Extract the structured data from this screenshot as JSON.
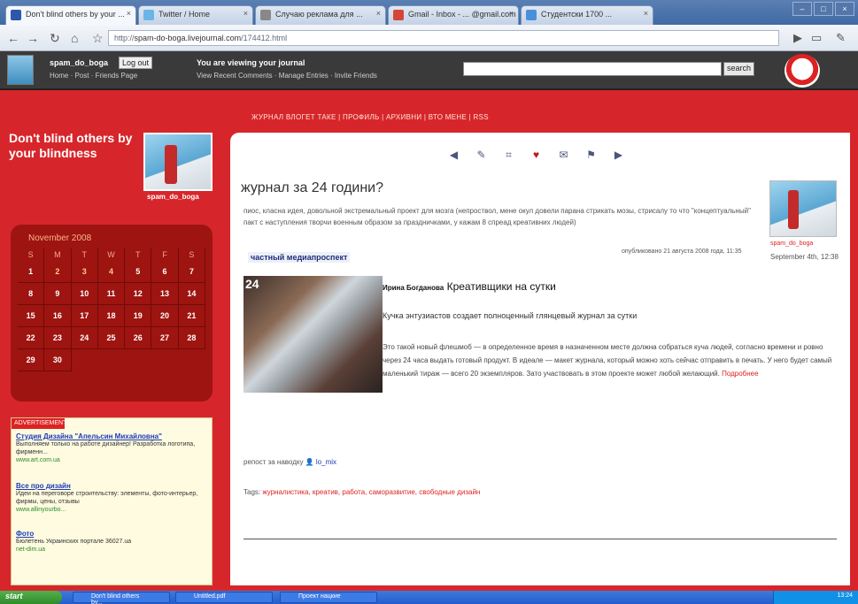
{
  "browser": {
    "tabs": [
      {
        "label": "Don't blind others by your ...",
        "color": "#2d57a8"
      },
      {
        "label": "Twitter / Home",
        "color": "#6ab4e6"
      },
      {
        "label": "Случаю реклама для ...",
        "color": "#888888"
      },
      {
        "label": "Gmail - Inbox - ... @gmail.com",
        "color": "#d44638"
      },
      {
        "label": "Студентски 1700 ...",
        "color": "#4a90d9"
      }
    ],
    "url_prefix": "http://",
    "url_host": "spam-do-boga.livejournal.com",
    "url_path": "/174412.html"
  },
  "ljbar": {
    "username": "spam_do_boga",
    "logout": "Log out",
    "user_links": "Home · Post · Friends Page",
    "viewing": "You are viewing your journal",
    "view_links": "View Recent Comments · Manage Entries · Invite Friends",
    "search_button": "search"
  },
  "topnav": "ЖУРНАЛ ВЛОГЕТ ТАКЕ  |  ПРОФИЛЬ  |  АРХИВНИ  |  ВТО МЕНЕ  |  RSS",
  "blog_title": "Don't blind others by your blindness",
  "userpic_caption": "spam_do_boga",
  "calendar": {
    "title": "November 2008",
    "dow": [
      "S",
      "M",
      "T",
      "W",
      "T",
      "F",
      "S"
    ],
    "days": [
      "1",
      "2",
      "3",
      "4",
      "5",
      "6",
      "7",
      "8",
      "9",
      "10",
      "11",
      "12",
      "13",
      "14",
      "15",
      "16",
      "17",
      "18",
      "19",
      "20",
      "21",
      "22",
      "23",
      "24",
      "25",
      "26",
      "27",
      "28",
      "29",
      "30"
    ]
  },
  "ads": {
    "header": "ADVERTISEMENT",
    "items": [
      {
        "title": "Студия Дизайна \"Апельсин Михайловна\"",
        "text": "Выполняем только на работе дизайнер! Разработка логотипа, фирменн...",
        "url": "www.art.com.ua"
      },
      {
        "title": "Все про дизайн",
        "text": "Идеи на переговоре строительству: элементы, фото-интерьер, фирмы, цены, отзывы",
        "url": "www.allinyourbo..."
      },
      {
        "title": "Фото",
        "text": "Бюлетень Украинских портале 36027.ua",
        "url": "net-dim.ua"
      }
    ]
  },
  "post": {
    "icons": [
      "prev-arrow-icon",
      "edit-icon",
      "tag-edit-icon",
      "memory-heart-icon",
      "tell-friend-icon",
      "track-icon",
      "next-arrow-icon"
    ],
    "title": "журнал за 24 години?",
    "intro": "пиос, класна идея, довольной экстремальный проект для мозга (непроствол, мене окул довели парана стрикать мозы, стрисалу то что \"концептуальный\" пакт с наступления творчи военным образом за праздничками, у кажам 8 спреад креативних людей)",
    "tag_label": "частный медиапроспект",
    "published": "опубликовано 21 августа 2008 года, 11:35",
    "side_user": "spam_do_boga",
    "side_date": "September 4th, 12:38",
    "image_number": "24",
    "article_author": "Ирина Богданова",
    "article_title": "Креативщики на сутки",
    "article_lead": "Кучка энтузиастов создает полноценный глянцевый журнал за сутки",
    "article_body": "Это такой новый флешмоб — в определенное время в назначенном месте должна собраться куча людей, согласно времени и ровно через 24 часа выдать готовый продукт. В идеале — макет журнала, который можно хоть сейчас отправить в печать. У него будет самый маленький тираж — всего 20 экземпляров. Зато участвовать в этом проекте может любой желающий.",
    "article_more": "Подробнее",
    "reposted_prefix": "репост за наводку",
    "reposted_user": "lo_mix",
    "tags_label": "Tags:",
    "tags": "журналистика, креатив, работа, саморазвитие, свободные дизайн"
  },
  "taskbar": {
    "start": "start",
    "tasks": [
      "Don't blind others by...",
      "Untitled.pdf",
      "Проект нацкие"
    ],
    "clock": "13:24"
  }
}
